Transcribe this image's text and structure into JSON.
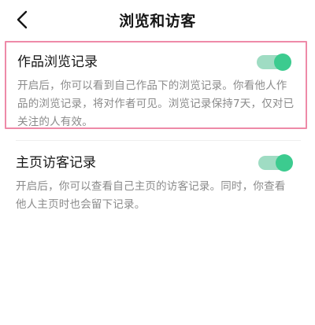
{
  "header": {
    "title": "浏览和访客"
  },
  "settings": [
    {
      "title": "作品浏览记录",
      "description": "开启后，你可以看到自己作品下的浏览记录。你看他人作品的浏览记录，将对作者可见。浏览记录保持7天，仅对已关注的人有效。",
      "enabled": true
    },
    {
      "title": "主页访客记录",
      "description": "开启后，你可以查看自己主页的访客记录。同时，你查看他人主页时也会留下记录。",
      "enabled": true
    }
  ],
  "colors": {
    "toggle_on_knob": "#3ccb8f",
    "toggle_on_track": "#9fdcc3",
    "highlight_border": "#ee8aa8"
  },
  "icons": {
    "back": "chevron-left-icon"
  }
}
